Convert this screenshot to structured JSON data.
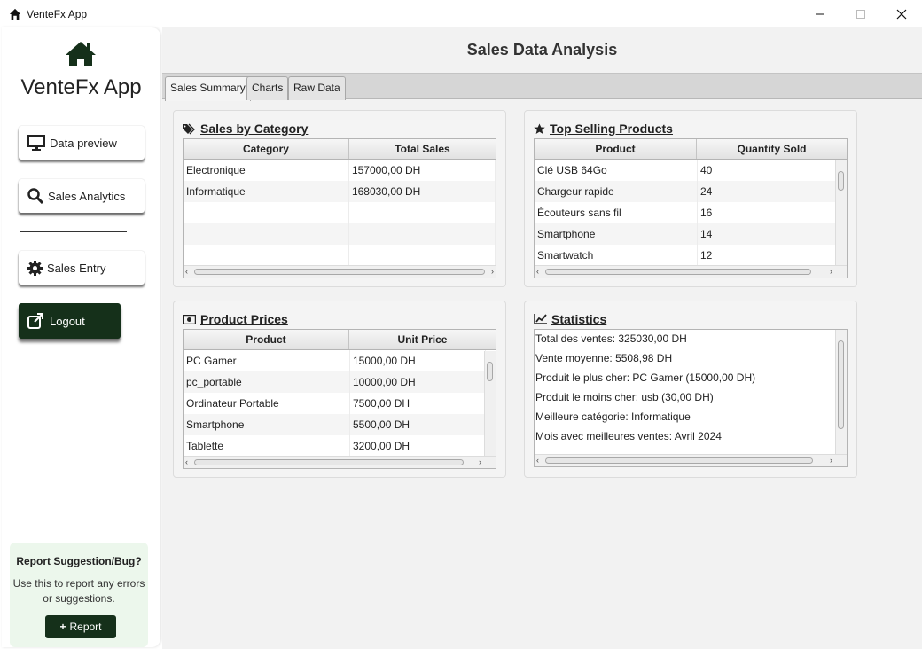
{
  "window": {
    "title": "VenteFx App"
  },
  "sidebar": {
    "app_name": "VenteFx App",
    "nav": [
      {
        "label": "Data preview",
        "icon": "monitor-icon"
      },
      {
        "label": "Sales Analytics",
        "icon": "search-icon"
      },
      {
        "label": "Sales Entry",
        "icon": "gear-icon"
      }
    ],
    "logout_label": "Logout",
    "report": {
      "title": "Report Suggestion/Bug?",
      "description": "Use this to report any errors or suggestions.",
      "button_label": "Report"
    }
  },
  "main": {
    "title": "Sales Data Analysis",
    "tabs": [
      "Sales Summary",
      "Charts",
      "Raw Data"
    ],
    "active_tab": "Sales Summary"
  },
  "sales_by_category": {
    "title": "Sales by Category",
    "columns": [
      "Category",
      "Total Sales"
    ],
    "rows": [
      [
        "Electronique",
        "157000,00 DH"
      ],
      [
        "Informatique",
        "168030,00 DH"
      ]
    ]
  },
  "top_selling": {
    "title": "Top Selling Products",
    "columns": [
      "Product",
      "Quantity Sold"
    ],
    "rows": [
      [
        "Clé USB 64Go",
        "40"
      ],
      [
        "Chargeur rapide",
        "24"
      ],
      [
        "Écouteurs sans fil",
        "16"
      ],
      [
        "Smartphone",
        "14"
      ],
      [
        "Smartwatch",
        "12"
      ]
    ]
  },
  "product_prices": {
    "title": "Product Prices",
    "columns": [
      "Product",
      "Unit Price"
    ],
    "rows": [
      [
        "PC Gamer",
        "15000,00 DH"
      ],
      [
        "pc_portable",
        "10000,00 DH"
      ],
      [
        "Ordinateur Portable",
        "7500,00 DH"
      ],
      [
        "Smartphone",
        "5500,00 DH"
      ],
      [
        "Tablette",
        "3200,00 DH"
      ]
    ]
  },
  "statistics": {
    "title": "Statistics",
    "lines": [
      "Total des ventes: 325030,00 DH",
      "Vente moyenne: 5508,98 DH",
      "Produit le plus cher: PC Gamer (15000,00 DH)",
      "Produit le moins cher: usb (30,00 DH)",
      "Meilleure catégorie: Informatique",
      "Mois avec meilleures ventes: Avril 2024"
    ]
  },
  "colors": {
    "dark_green": "#15301a",
    "report_bg": "#ecf7ec",
    "main_bg": "#f2f2f2"
  }
}
